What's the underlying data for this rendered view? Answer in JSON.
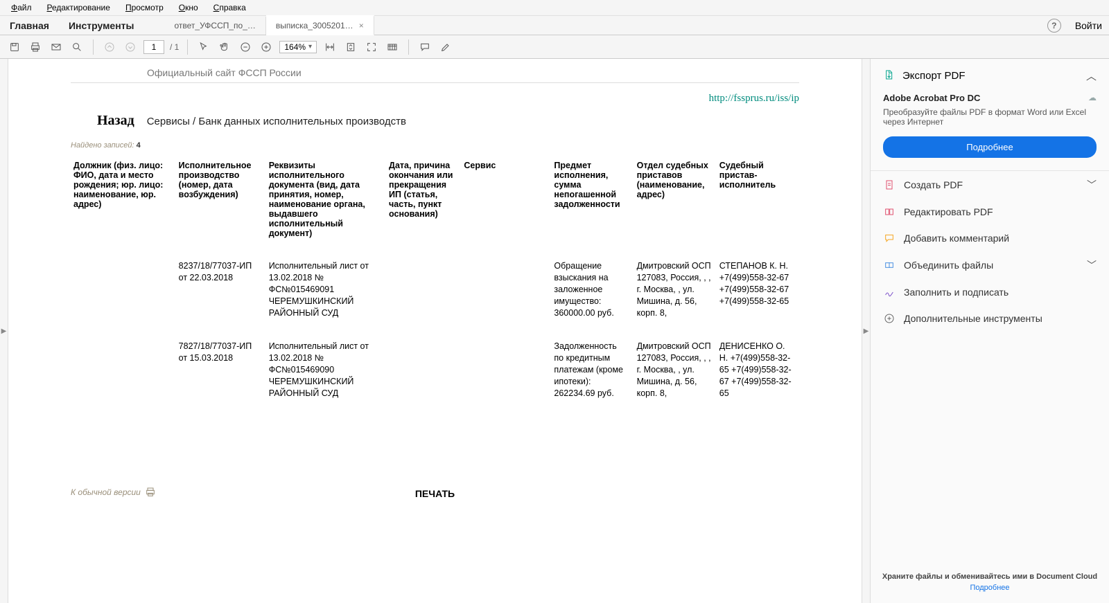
{
  "menu": {
    "file": "Файл",
    "edit": "Редактирование",
    "view": "Просмотр",
    "window": "Окно",
    "help": "Справка"
  },
  "tabs": {
    "home": "Главная",
    "tools": "Инструменты",
    "doc1": "ответ_УФССП_по_…",
    "doc2": "выписка_3005201…",
    "help": "?",
    "login": "Войти"
  },
  "toolbar": {
    "page_current": "1",
    "page_total": "/ 1",
    "zoom": "164%"
  },
  "doc": {
    "sitehead": "Официальный сайт ФССП России",
    "url": "http://fssprus.ru/iss/ip",
    "back": "Назад",
    "crumbs": "Сервисы  /  Банк данных исполнительных производств",
    "found_label": "Найдено записей: ",
    "found_count": "4",
    "headers": {
      "c1": "Должник (физ. лицо: ФИО, дата и место рождения; юр. лицо: наименование, юр. адрес)",
      "c2": "Исполнительное производство (номер, дата возбуждения)",
      "c3": "Реквизиты исполнительного документа (вид, дата принятия, номер, наименование органа, выдавшего исполнительный документ)",
      "c4": "Дата, причина окончания или прекращения ИП (статья, часть, пункт основания)",
      "c5": "Сервис",
      "c6": "Предмет исполнения, сумма непогашенной задолженности",
      "c7": "Отдел судебных приставов (наименование, адрес)",
      "c8": "Судебный пристав-исполнитель"
    },
    "rows": [
      {
        "c2": "8237/18/77037-ИП от 22.03.2018",
        "c3": "Исполнительный лист от 13.02.2018 № ФС№015469091 ЧЕРЕМУШКИНСКИЙ РАЙОННЫЙ СУД",
        "c6": "Обращение взыскания на заложенное имущество: 360000.00 руб.",
        "c7": "Дмитровский ОСП 127083, Россия, , , г. Москва, , ул. Мишина, д. 56, корп. 8,",
        "c8": "СТЕПАНОВ К. Н. +7(499)558-32-67 +7(499)558-32-67 +7(499)558-32-65"
      },
      {
        "c2": "7827/18/77037-ИП от 15.03.2018",
        "c3": "Исполнительный лист от 13.02.2018 № ФС№015469090 ЧЕРЕМУШКИНСКИЙ РАЙОННЫЙ СУД",
        "c6": "Задолженность по кредитным платежам (кроме ипотеки): 262234.69 руб.",
        "c7": "Дмитровский ОСП 127083, Россия, , , г. Москва, , ул. Мишина, д. 56, корп. 8,",
        "c8": "ДЕНИСЕНКО О. Н. +7(499)558-32-65 +7(499)558-32-67 +7(499)558-32-65"
      }
    ],
    "normalver": "К обычной версии",
    "print": "ПЕЧАТЬ"
  },
  "right": {
    "export_head": "Экспорт PDF",
    "app_title": "Adobe Acrobat Pro DC",
    "app_desc": "Преобразуйте файлы PDF в формат Word или Excel через Интернет",
    "more_btn": "Подробнее",
    "tools": {
      "create": "Создать PDF",
      "edit": "Редактировать PDF",
      "comment": "Добавить комментарий",
      "combine": "Объединить файлы",
      "fillsign": "Заполнить и подписать",
      "moretools": "Дополнительные инструменты"
    },
    "footer_bold": "Храните файлы и обменивайтесь ими в Document Cloud",
    "footer_link": "Подробнее"
  }
}
